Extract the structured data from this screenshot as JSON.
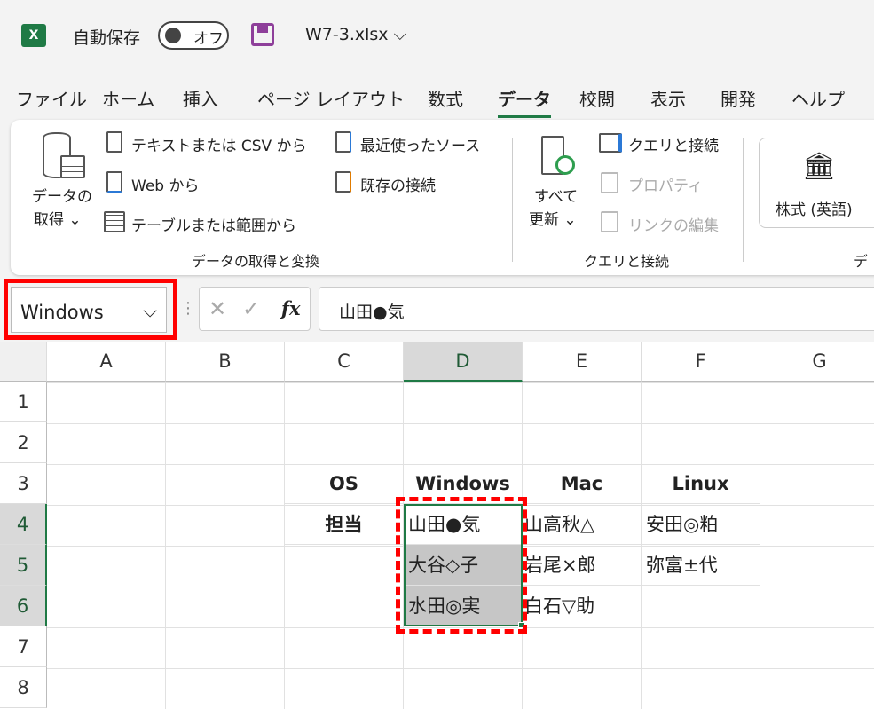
{
  "titlebar": {
    "app_icon": "X",
    "autosave_label": "自動保存",
    "autosave_state": "オフ",
    "filename": "W7-3.xlsx"
  },
  "tabs": [
    "ファイル",
    "ホーム",
    "挿入",
    "ページ レイアウト",
    "数式",
    "データ",
    "校閲",
    "表示",
    "開発",
    "ヘルプ"
  ],
  "active_tab": "データ",
  "ribbon": {
    "get_data": "データの",
    "get_data2": "取得",
    "from_text": "テキストまたは CSV から",
    "from_web": "Web から",
    "from_table": "テーブルまたは範囲から",
    "recent_sources": "最近使ったソース",
    "existing_connections": "既存の接続",
    "group1": "データの取得と変換",
    "refresh_all": "すべて",
    "refresh_all2": "更新",
    "queries_connections": "クエリと接続",
    "properties": "プロパティ",
    "edit_links": "リンクの編集",
    "group2": "クエリと接続",
    "stocks": "株式 (英語)",
    "group3": "デ"
  },
  "formula_bar": {
    "name_box": "Windows",
    "formula": "山田●気",
    "fx": "fx"
  },
  "columns": [
    "A",
    "B",
    "C",
    "D",
    "E",
    "F",
    "G"
  ],
  "rows": [
    "1",
    "2",
    "3",
    "4",
    "5",
    "6",
    "7",
    "8"
  ],
  "cells": {
    "C3": "OS",
    "D3": "Windows",
    "E3": "Mac",
    "F3": "Linux",
    "C4": "担当",
    "D4": "山田●気",
    "E4": "山高秋△",
    "F4": "安田◎粕",
    "D5": "大谷◇子",
    "E5": "岩尾×郎",
    "F5": "弥富±代",
    "D6": "水田◎実",
    "E6": "白石▽助"
  },
  "colors": {
    "accent": "#1f7a45",
    "highlight": "#ff0000"
  }
}
